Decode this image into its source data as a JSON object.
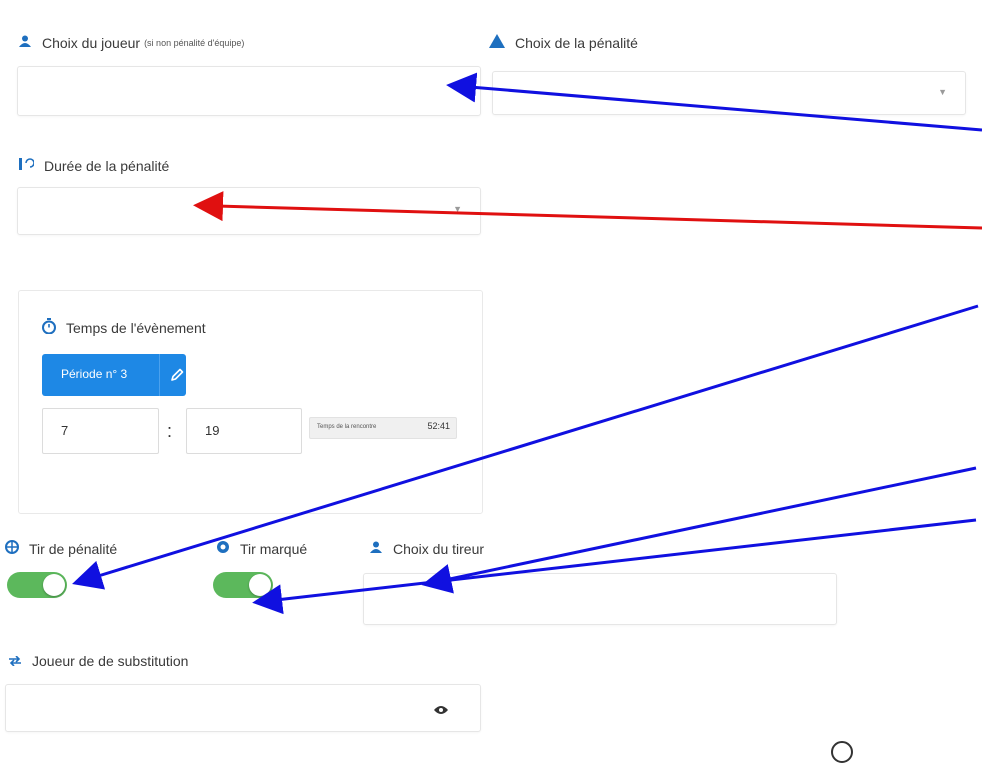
{
  "player_choice": {
    "label": "Choix du joueur",
    "note": "(si non pénalité d'équipe)",
    "value": ""
  },
  "penalty_choice": {
    "label": "Choix de la pénalité",
    "value": ""
  },
  "penalty_duration": {
    "label": "Durée de la pénalité",
    "value": ""
  },
  "event_time": {
    "label": "Temps de l'évènement",
    "period_button": "Période n° 3",
    "minutes": "7",
    "separator": ":",
    "seconds": "19",
    "match_time_label": "Temps de la rencontre",
    "match_time_value": "52:41"
  },
  "penalty_shot": {
    "label": "Tir de pénalité",
    "on": true
  },
  "shot_scored": {
    "label": "Tir marqué",
    "on": true
  },
  "shooter_choice": {
    "label": "Choix du tireur",
    "value": ""
  },
  "substitute_player": {
    "label": "Joueur de de substitution",
    "value": ""
  },
  "colors": {
    "accent": "#1e88e5",
    "toggle_on": "#5cb85c",
    "annotation_blue": "#1010e0",
    "annotation_red": "#e01010"
  },
  "icons": [
    "user-icon",
    "warning-icon",
    "duration-icon",
    "stopwatch-icon",
    "edit-pencil-icon",
    "target-icon",
    "scored-icon",
    "swap-icon",
    "eye-icon",
    "chevron-down-icon"
  ]
}
